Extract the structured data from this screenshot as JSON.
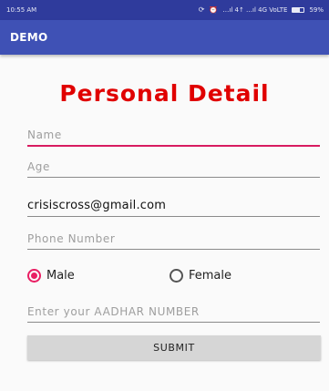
{
  "status_bar": {
    "time": "10:55 AM",
    "signal_text": "…ıl 4↑ …ıl 4G VoLTE",
    "battery_text": "59%"
  },
  "app_bar": {
    "title": "DEMO"
  },
  "form": {
    "title": "Personal Detail",
    "name": {
      "placeholder": "Name"
    },
    "age": {
      "placeholder": "Age"
    },
    "email": {
      "value": "crisiscross@gmail.com"
    },
    "phone": {
      "placeholder": "Phone Number"
    },
    "gender": {
      "options": [
        "Male",
        "Female"
      ],
      "selected": "Male"
    },
    "aadhar": {
      "placeholder": "Enter your AADHAR NUMBER"
    },
    "submit_label": "SUBMIT"
  },
  "colors": {
    "status_bar": "#2f3b9c",
    "app_bar": "#3f51b5",
    "title_red": "#e00000",
    "accent_pink": "#e91e63"
  }
}
